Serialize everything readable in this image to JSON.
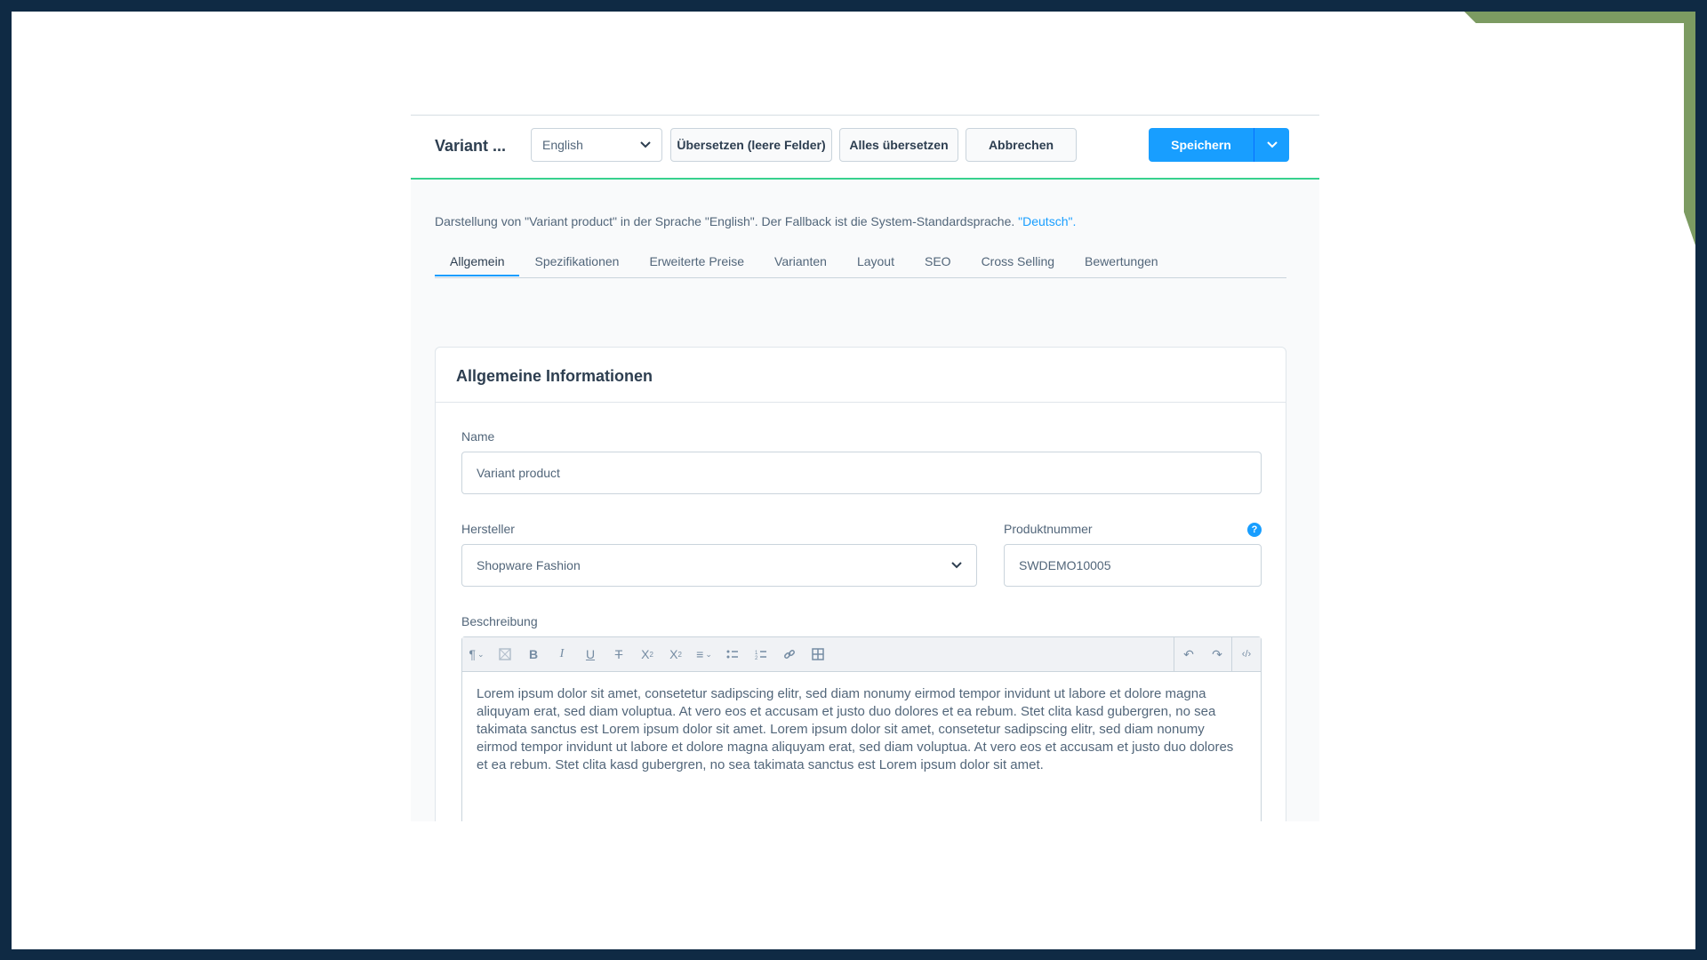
{
  "header": {
    "title": "Variant ...",
    "language": "English",
    "translate_empty_label": "Übersetzen (leere Felder)",
    "translate_all_label": "Alles übersetzen",
    "cancel_label": "Abbrechen",
    "save_label": "Speichern"
  },
  "info": {
    "text": "Darstellung von \"Variant product\" in der Sprache \"English\". Der Fallback ist die System-Standardsprache. ",
    "link": "\"Deutsch\"."
  },
  "tabs": [
    {
      "label": "Allgemein",
      "active": true
    },
    {
      "label": "Spezifikationen"
    },
    {
      "label": "Erweiterte Preise"
    },
    {
      "label": "Varianten"
    },
    {
      "label": "Layout"
    },
    {
      "label": "SEO"
    },
    {
      "label": "Cross Selling"
    },
    {
      "label": "Bewertungen"
    }
  ],
  "card": {
    "title": "Allgemeine Informationen",
    "name": {
      "label": "Name",
      "value": "Variant product"
    },
    "manufacturer": {
      "label": "Hersteller",
      "value": "Shopware Fashion"
    },
    "product_number": {
      "label": "Produktnummer",
      "value": "SWDEMO10005",
      "help": "?"
    },
    "description": {
      "label": "Beschreibung",
      "text": "Lorem ipsum dolor sit amet, consetetur sadipscing elitr, sed diam nonumy eirmod tempor invidunt ut labore et dolore magna aliquyam erat, sed diam voluptua. At vero eos et accusam et justo duo dolores et ea rebum. Stet clita kasd gubergren, no sea takimata sanctus est Lorem ipsum dolor sit amet. Lorem ipsum dolor sit amet, consetetur sadipscing elitr, sed diam nonumy eirmod tempor invidunt ut labore et dolore magna aliquyam erat, sed diam voluptua. At vero eos et accusam et justo duo dolores et ea rebum. Stet clita kasd gubergren, no sea takimata sanctus est Lorem ipsum dolor sit amet."
    }
  },
  "toolbar_icons": [
    "paragraph-icon",
    "clear-format-icon",
    "bold-icon",
    "italic-icon",
    "underline-icon",
    "strikethrough-icon",
    "superscript-icon",
    "subscript-icon",
    "align-icon",
    "bullet-list-icon",
    "numbered-list-icon",
    "link-icon",
    "table-icon",
    "undo-icon",
    "redo-icon",
    "code-view-icon"
  ],
  "colors": {
    "accent": "#189eff",
    "success_line": "#37d18e",
    "frame": "#0f2a44",
    "deco": "#7c9b62"
  }
}
